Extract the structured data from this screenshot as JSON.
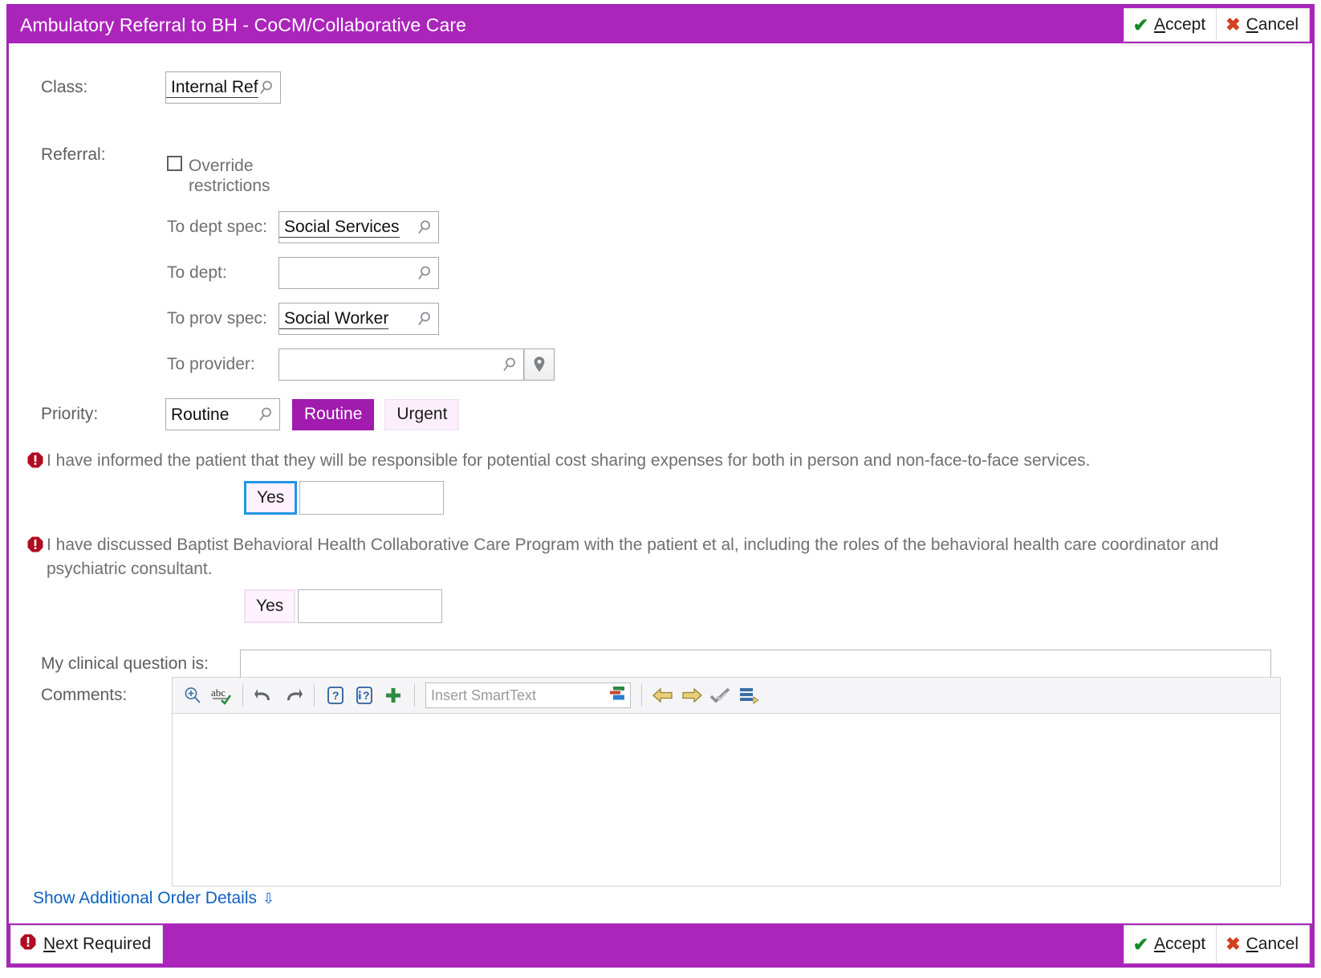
{
  "window": {
    "title": "Ambulatory Referral to BH - CoCM/Collaborative Care",
    "accent_color": "#ab25bb",
    "accept_label": "Accept",
    "accept_accel": "A",
    "cancel_label": "Cancel",
    "cancel_accel": "C"
  },
  "form": {
    "class_label": "Class:",
    "class_value": "Internal Ref",
    "referral_label": "Referral:",
    "override_label_line1": "Override",
    "override_label_line2": "restrictions",
    "override_checked": false,
    "to_dept_spec_label": "To dept spec:",
    "to_dept_spec_value": "Social Services",
    "to_dept_label": "To dept:",
    "to_dept_value": "",
    "to_prov_spec_label": "To prov spec:",
    "to_prov_spec_value": "Social Worker",
    "to_provider_label": "To provider:",
    "to_provider_value": "",
    "priority_label": "Priority:",
    "priority_value": "Routine",
    "priority_options": [
      "Routine",
      "Urgent"
    ],
    "priority_selected": "Routine"
  },
  "questions": [
    {
      "text": "I have informed the patient that they will be responsible for potential cost sharing expenses for both in person and non-face-to-face services.",
      "answer": "Yes",
      "focused": true,
      "comment": ""
    },
    {
      "text": "I have discussed Baptist Behavioral Health Collaborative Care Program with the patient et al, including the roles of the behavioral health care coordinator and psychiatric consultant.",
      "answer": "Yes",
      "focused": false,
      "comment": ""
    }
  ],
  "clinical_question": {
    "label": "My clinical question is:",
    "value": ""
  },
  "comments": {
    "label": "Comments:",
    "value": "",
    "smarttext_placeholder": "Insert SmartText",
    "toolbar_icons": [
      "zoom-in-icon",
      "spellcheck-icon",
      "undo-icon",
      "redo-icon",
      "question-icon",
      "question-info-icon",
      "add-icon",
      "smarttext-list-icon",
      "previous-wildcard-icon",
      "next-wildcard-icon",
      "accept-wildcards-icon",
      "smartlist-icon"
    ]
  },
  "additional": {
    "show_details_label": "Show Additional Order Details"
  },
  "footer": {
    "next_required_label": "Next Required",
    "next_required_accel": "N",
    "accept_label": "Accept",
    "accept_accel": "A",
    "cancel_label": "Cancel",
    "cancel_accel": "C"
  }
}
